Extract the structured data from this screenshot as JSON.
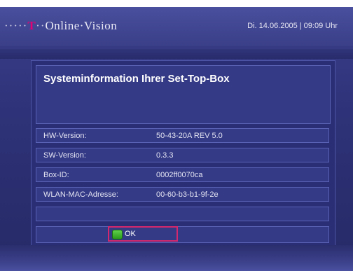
{
  "header": {
    "logo_dots": "·····",
    "logo_t": "T",
    "logo_sep": "··",
    "logo_text": "Online·Vision",
    "datetime": "Di. 14.06.2005 | 09:09 Uhr"
  },
  "panel": {
    "title": "Systeminformation Ihrer Set-Top-Box",
    "rows": [
      {
        "label": "HW-Version:",
        "value": "50-43-20A REV 5.0"
      },
      {
        "label": "SW-Version:",
        "value": "0.3.3"
      },
      {
        "label": "Box-ID:",
        "value": "0002ff0070ca"
      },
      {
        "label": "WLAN-MAC-Adresse:",
        "value": "00-60-b3-b1-9f-2e"
      },
      {
        "label": "",
        "value": ""
      }
    ],
    "ok_label": "OK"
  },
  "colors": {
    "accent_magenta": "#e20074",
    "ok_border": "#d3286e",
    "ok_green": "#3cb82a",
    "background": "#2e3278"
  },
  "icons": {
    "ok_button_icon": "green-square-icon"
  }
}
